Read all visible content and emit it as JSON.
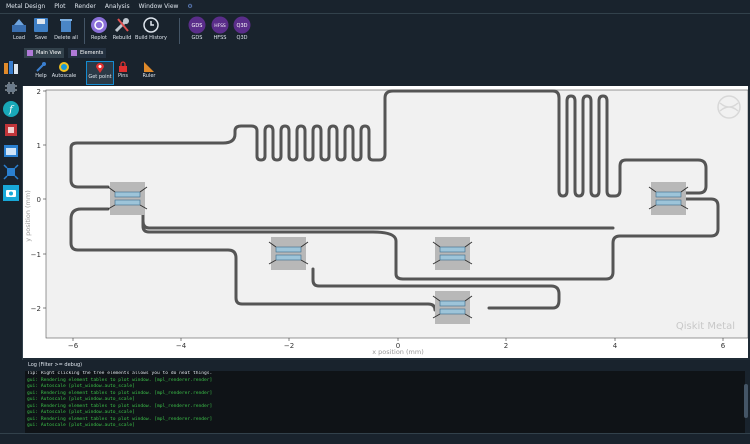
{
  "menu": [
    "Metal Design",
    "Plot",
    "Render",
    "Analysis",
    "Window View"
  ],
  "toolbar": {
    "load": "Load",
    "save": "Save",
    "delete_all": "Delete all",
    "replot": "Replot",
    "rebuild": "Rebuild",
    "build_history": "Build History",
    "gds": "GDS",
    "hfss": "HFSS",
    "q3d": "Q3D"
  },
  "tabs": {
    "main_view": "Main View",
    "elements": "Elements"
  },
  "plot_tools": {
    "help": "Help",
    "autoscale": "Autoscale",
    "get_point": "Get point",
    "pins": "Pins",
    "ruler": "Ruler"
  },
  "plot": {
    "xlabel": "x position (mm)",
    "ylabel": "y position (mm)",
    "xticks": [
      "−6",
      "−4",
      "−2",
      "0",
      "2",
      "4",
      "6"
    ],
    "yticks": [
      "2",
      "1",
      "0",
      "−1",
      "−2"
    ],
    "watermark": "Qiskit Metal"
  },
  "log": {
    "title": "Log  (Filter >= debug)",
    "hint": "Tip: Right clicking the tree elements allows you to do neat things.",
    "lines": [
      "gui: Rendering element tables to plot window. [mpl_renderer.render]",
      "gui: Autoscale  [plot_window.auto_scale]",
      "gui: Rendering element tables to plot window. [mpl_renderer.render]",
      "gui: Autoscale  [plot_window.auto_scale]",
      "gui: Rendering element tables to plot window. [mpl_renderer.render]",
      "gui: Autoscale  [plot_window.auto_scale]",
      "gui: Rendering element tables to plot window. [mpl_renderer.render]",
      "gui: Autoscale  [plot_window.auto_scale]"
    ]
  },
  "colors": {
    "accent": "#148cd2",
    "log_text": "#3cc24a",
    "route": "#555555",
    "qubit": "#9dc4d9"
  }
}
